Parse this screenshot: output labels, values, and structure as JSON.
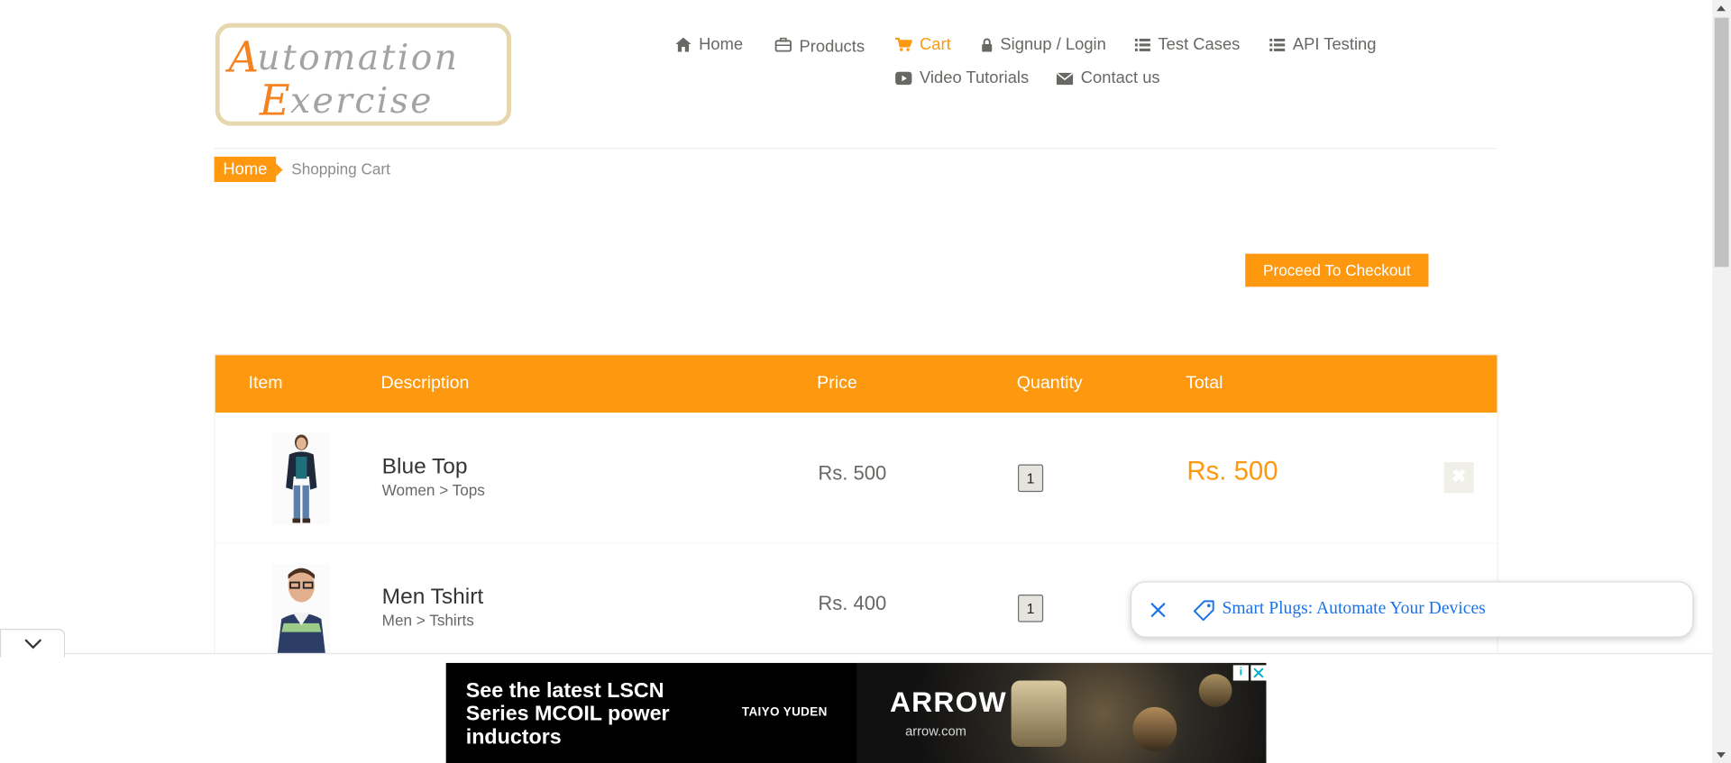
{
  "logo": {
    "alt": "Automation Exercise",
    "line1_cap": "A",
    "line1_rest": "utomation",
    "line2_cap": "E",
    "line2_rest": "xercise"
  },
  "nav": {
    "home": "Home",
    "products": "Products",
    "cart": "Cart",
    "signup_login": "Signup / Login",
    "test_cases": "Test Cases",
    "api_testing": "API Testing",
    "video_tutorials": "Video Tutorials",
    "contact_us": "Contact us"
  },
  "breadcrumb": {
    "home": "Home",
    "current": "Shopping Cart"
  },
  "checkout_button": "Proceed To Checkout",
  "table": {
    "headers": {
      "item": "Item",
      "description": "Description",
      "price": "Price",
      "quantity": "Quantity",
      "total": "Total"
    },
    "rows": [
      {
        "name": "Blue Top",
        "category": "Women > Tops",
        "price": "Rs. 500",
        "quantity": "1",
        "total": "Rs. 500"
      },
      {
        "name": "Men Tshirt",
        "category": "Men > Tshirts",
        "price": "Rs. 400",
        "quantity": "1",
        "total": ""
      }
    ]
  },
  "popup": {
    "text": "Smart Plugs: Automate Your Devices"
  },
  "ad": {
    "headline": "See the latest LSCN Series MCOIL power inductors",
    "brand": "TAIYO YUDEN",
    "logo": "ARROW",
    "url": "arrow.com",
    "info": "i"
  },
  "colors": {
    "accent": "#fe980f",
    "link": "#1a73e8"
  }
}
